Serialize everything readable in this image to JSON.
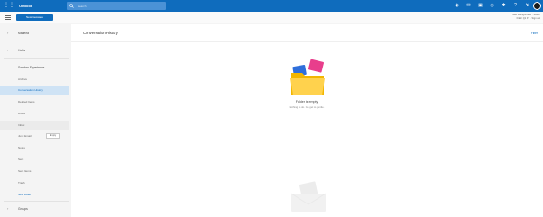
{
  "app": {
    "name": "Outlook"
  },
  "search": {
    "placeholder": "Search"
  },
  "top_icons": [
    "skype-icon",
    "chat-icon",
    "calendar-icon",
    "people-icon",
    "settings-icon",
    "help-icon",
    "feedback-icon"
  ],
  "second_bar": {
    "new_message_label": "New message"
  },
  "account": {
    "line1": "Sian Montgomerie · Switch",
    "line2": "Filed: Q1 FY · Sign out"
  },
  "sidebar": {
    "groups": [
      {
        "label": "Madeira",
        "expanded": false
      },
      {
        "label": "Hollis",
        "expanded": false
      },
      {
        "label": "Sweden Experience",
        "expanded": true
      },
      {
        "label": "Groups",
        "expanded": false
      }
    ],
    "folders": [
      {
        "label": "Archive"
      },
      {
        "label": "Conversation History",
        "selected": true
      },
      {
        "label": "Deleted Items"
      },
      {
        "label": "Drafts"
      },
      {
        "label": "Inbox"
      },
      {
        "label": "Junk Email",
        "action": "Empty"
      },
      {
        "label": "Notes"
      },
      {
        "label": "Sent"
      },
      {
        "label": "Sent Items"
      },
      {
        "label": "Trash"
      },
      {
        "label": "New folder",
        "link": true
      }
    ]
  },
  "main": {
    "title": "Conversation History",
    "filter_label": "Filter",
    "empty_title": "Folder is empty",
    "empty_subtitle": "Nothing to do. Go get to gentle."
  },
  "colors": {
    "brand": "#0f6cbd",
    "selected_bg": "#cfe3f5",
    "sidebar_bg": "#f4f4f4"
  }
}
